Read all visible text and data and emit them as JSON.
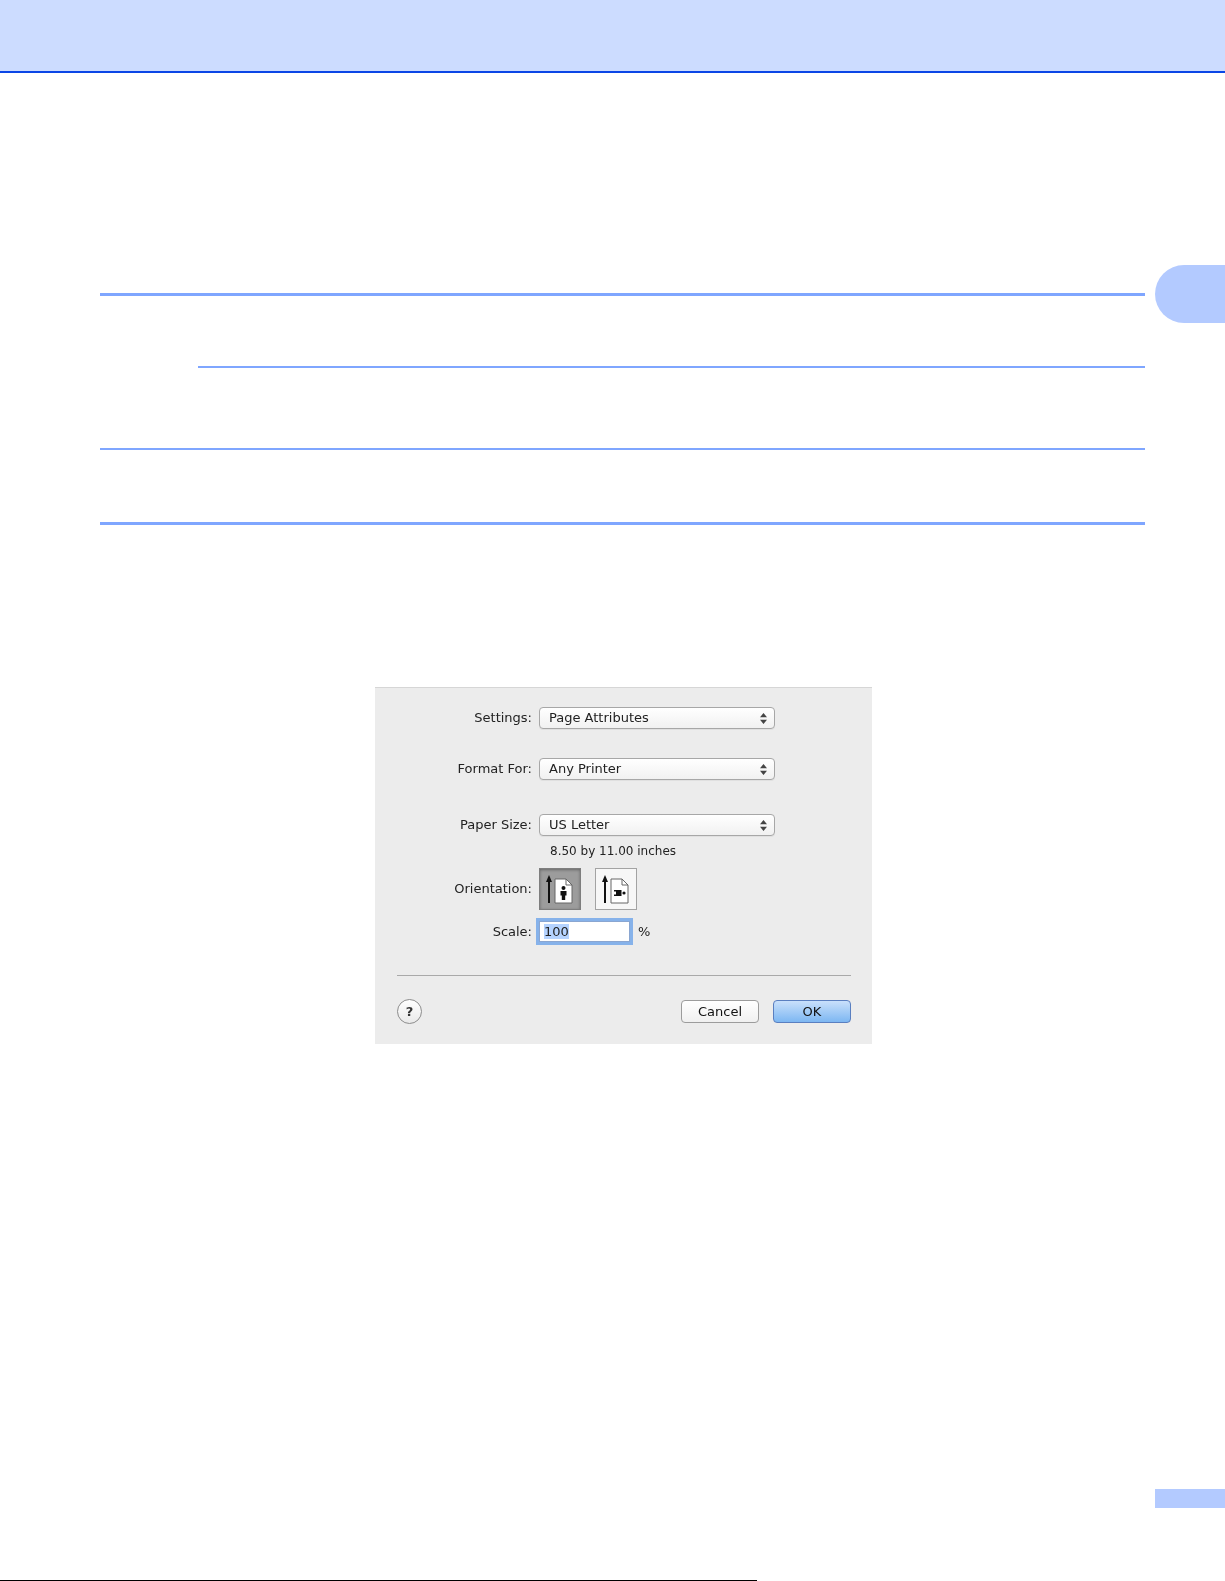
{
  "dialog": {
    "fields": [
      {
        "kind": "select",
        "label": "Settings:",
        "value": "Page Attributes"
      },
      {
        "kind": "select",
        "label": "Format For:",
        "value": "Any Printer"
      },
      {
        "kind": "select",
        "label": "Paper Size:",
        "value": "US Letter",
        "note": "8.50 by 11.00 inches"
      },
      {
        "kind": "orientation",
        "label": "Orientation:",
        "options": [
          {
            "kind": "portrait",
            "selected": true
          },
          {
            "kind": "landscape",
            "selected": false
          }
        ]
      },
      {
        "kind": "text",
        "label": "Scale:",
        "value": "100",
        "text_selected": true,
        "unit": "%"
      }
    ],
    "help_button": {
      "label": "?"
    },
    "buttons": [
      {
        "label": "Cancel",
        "default": false
      },
      {
        "label": "OK",
        "default": true
      }
    ]
  }
}
